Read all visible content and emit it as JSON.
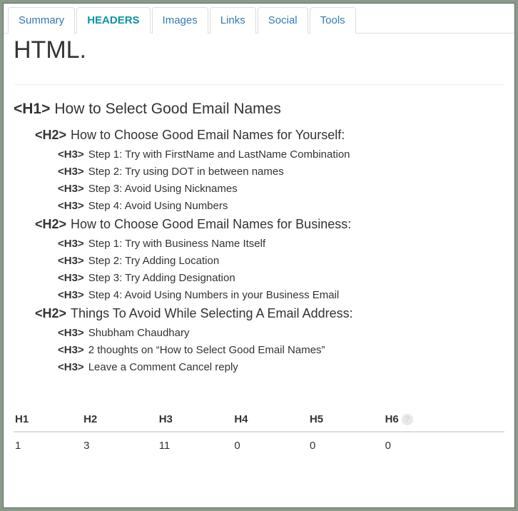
{
  "tabs": [
    {
      "label": "Summary",
      "active": false
    },
    {
      "label": "HEADERS",
      "active": true
    },
    {
      "label": "Images",
      "active": false
    },
    {
      "label": "Links",
      "active": false
    },
    {
      "label": "Social",
      "active": false
    },
    {
      "label": "Tools",
      "active": false
    }
  ],
  "top_label": "HTML.",
  "headings": [
    {
      "level": 1,
      "tag": "<H1>",
      "text": "How to Select Good Email Names"
    },
    {
      "level": 2,
      "tag": "<H2>",
      "text": "How to Choose Good Email Names for Yourself:"
    },
    {
      "level": 3,
      "tag": "<H3>",
      "text": "Step 1: Try with FirstName and LastName Combination"
    },
    {
      "level": 3,
      "tag": "<H3>",
      "text": "Step 2: Try using DOT in between names"
    },
    {
      "level": 3,
      "tag": "<H3>",
      "text": "Step 3: Avoid Using Nicknames"
    },
    {
      "level": 3,
      "tag": "<H3>",
      "text": "Step 4: Avoid Using Numbers"
    },
    {
      "level": 2,
      "tag": "<H2>",
      "text": "How to Choose Good Email Names for Business:"
    },
    {
      "level": 3,
      "tag": "<H3>",
      "text": "Step 1: Try with Business Name Itself"
    },
    {
      "level": 3,
      "tag": "<H3>",
      "text": "Step 2: Try Adding Location"
    },
    {
      "level": 3,
      "tag": "<H3>",
      "text": "Step 3: Try Adding Designation"
    },
    {
      "level": 3,
      "tag": "<H3>",
      "text": "Step 4: Avoid Using Numbers in your Business Email"
    },
    {
      "level": 2,
      "tag": "<H2>",
      "text": "Things To Avoid While Selecting A Email Address:"
    },
    {
      "level": 3,
      "tag": "<H3>",
      "text": "Shubham Chaudhary"
    },
    {
      "level": 3,
      "tag": "<H3>",
      "text": "2 thoughts on “How to Select Good Email Names”"
    },
    {
      "level": 3,
      "tag": "<H3>",
      "text": "Leave a Comment Cancel reply"
    }
  ],
  "summary": {
    "columns": [
      "H1",
      "H2",
      "H3",
      "H4",
      "H5",
      "H6"
    ],
    "values": [
      "1",
      "3",
      "11",
      "0",
      "0",
      "0"
    ]
  },
  "help_glyph": "?"
}
